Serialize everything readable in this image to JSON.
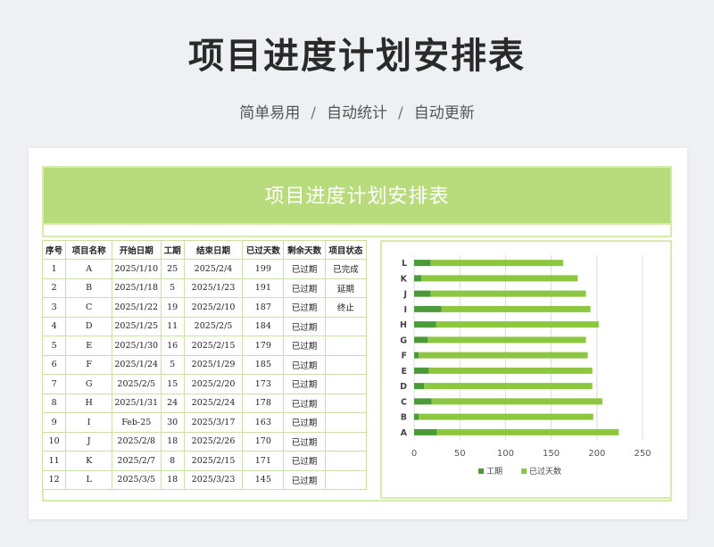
{
  "page": {
    "title": "项目进度计划安排表",
    "subtitle": [
      "简单易用",
      "自动统计",
      "自动更新"
    ],
    "subtitle_sep": "/"
  },
  "sheet": {
    "banner_title": "项目进度计划安排表",
    "accent_color": "#b8db7c"
  },
  "table": {
    "headers": [
      "序号",
      "项目名称",
      "开始日期",
      "工期",
      "结束日期",
      "已过天数",
      "剩余天数",
      "项目状态"
    ],
    "rows": [
      [
        "1",
        "A",
        "2025/1/10",
        "25",
        "2025/2/4",
        "199",
        "已过期",
        "已完成"
      ],
      [
        "2",
        "B",
        "2025/1/18",
        "5",
        "2025/1/23",
        "191",
        "已过期",
        "延期"
      ],
      [
        "3",
        "C",
        "2025/1/22",
        "19",
        "2025/2/10",
        "187",
        "已过期",
        "终止"
      ],
      [
        "4",
        "D",
        "2025/1/25",
        "11",
        "2025/2/5",
        "184",
        "已过期",
        ""
      ],
      [
        "5",
        "E",
        "2025/1/30",
        "16",
        "2025/2/15",
        "179",
        "已过期",
        ""
      ],
      [
        "6",
        "F",
        "2025/1/24",
        "5",
        "2025/1/29",
        "185",
        "已过期",
        ""
      ],
      [
        "7",
        "G",
        "2025/2/5",
        "15",
        "2025/2/20",
        "173",
        "已过期",
        ""
      ],
      [
        "8",
        "H",
        "2025/1/31",
        "24",
        "2025/2/24",
        "178",
        "已过期",
        ""
      ],
      [
        "9",
        "I",
        "Feb-25",
        "30",
        "2025/3/17",
        "163",
        "已过期",
        ""
      ],
      [
        "10",
        "J",
        "2025/2/8",
        "18",
        "2025/2/26",
        "170",
        "已过期",
        ""
      ],
      [
        "11",
        "K",
        "2025/2/7",
        "8",
        "2025/2/15",
        "171",
        "已过期",
        ""
      ],
      [
        "12",
        "L",
        "2025/3/5",
        "18",
        "2025/3/23",
        "145",
        "已过期",
        ""
      ]
    ]
  },
  "chart_data": {
    "type": "bar",
    "orientation": "horizontal",
    "stacked": true,
    "categories": [
      "A",
      "B",
      "C",
      "D",
      "E",
      "F",
      "G",
      "H",
      "I",
      "J",
      "K",
      "L"
    ],
    "series": [
      {
        "name": "工期",
        "color": "#4a9a3a",
        "values": [
          25,
          5,
          19,
          11,
          16,
          5,
          15,
          24,
          30,
          18,
          8,
          18
        ]
      },
      {
        "name": "已过天数",
        "color": "#8dc63f",
        "values": [
          199,
          191,
          187,
          184,
          179,
          185,
          173,
          178,
          163,
          170,
          171,
          145
        ]
      }
    ],
    "xlim": [
      0,
      250
    ],
    "xticks": [
      0,
      50,
      100,
      150,
      200,
      250
    ],
    "grid": true,
    "legend": "bottom"
  }
}
